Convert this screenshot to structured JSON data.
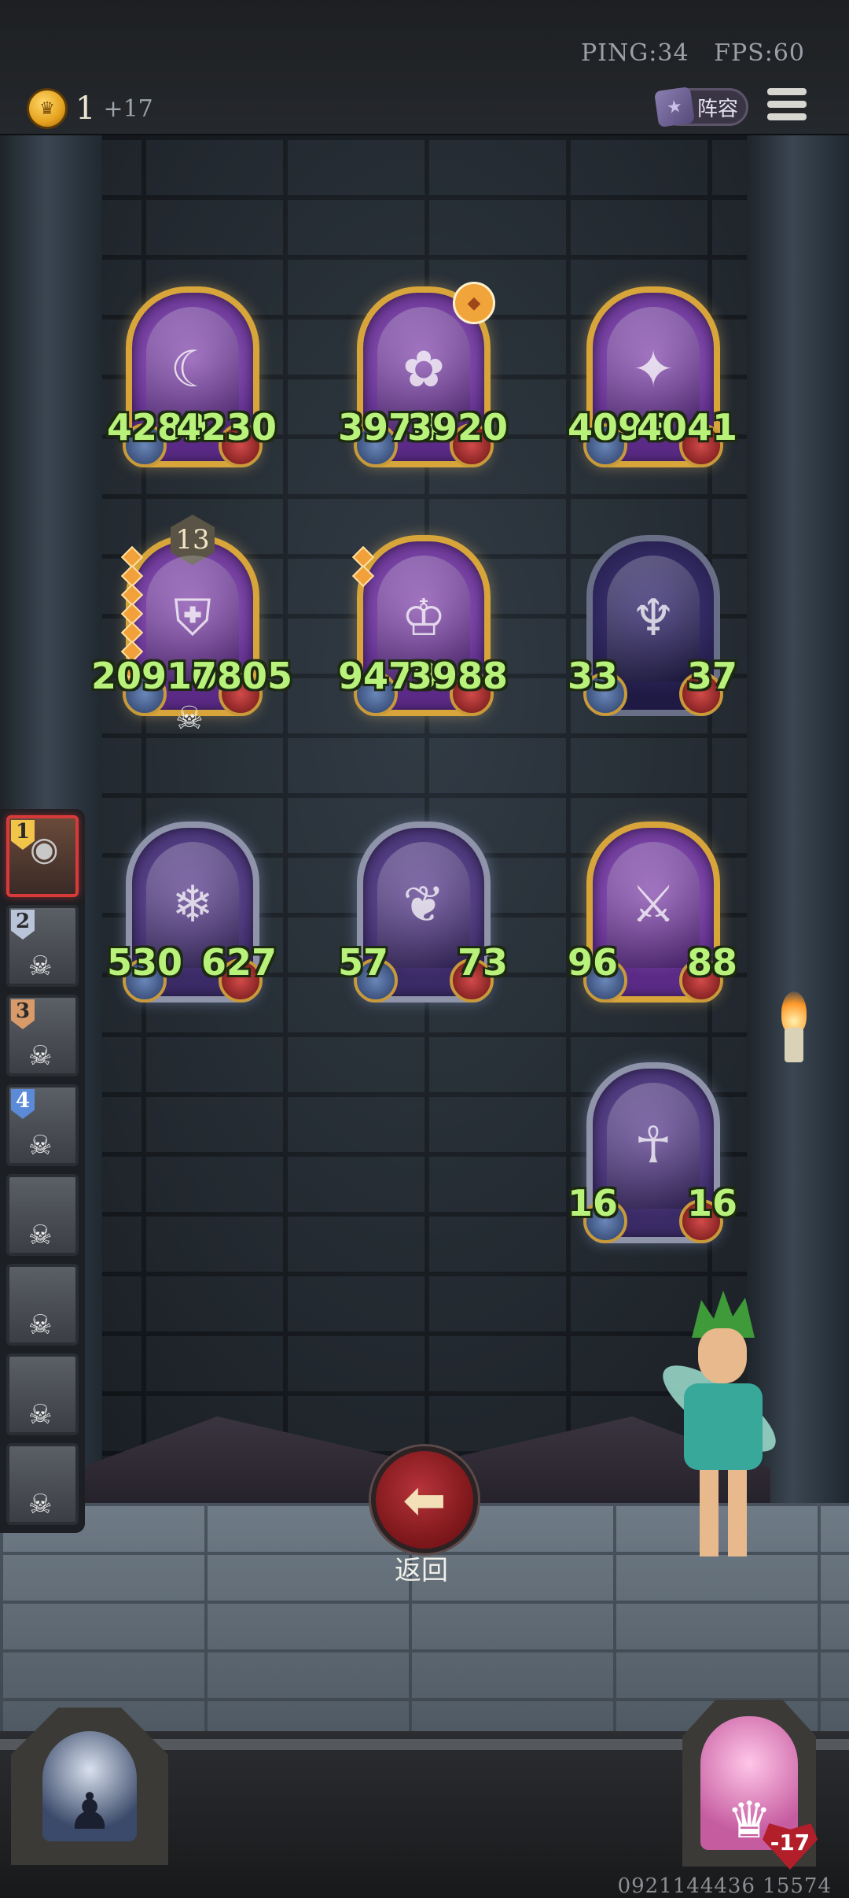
{
  "topbar": {
    "ping": "PING:34",
    "fps": "FPS:60",
    "gold_value": "1",
    "gold_income": "+17",
    "lineup_label": "阵容"
  },
  "board": {
    "row1": [
      {
        "atk": "4289",
        "hp": "4230"
      },
      {
        "atk": "3974",
        "hp": "3920"
      },
      {
        "atk": "4096",
        "hp": "4041"
      }
    ],
    "row2": [
      {
        "atk": "20910",
        "hp": "17805",
        "level": "13"
      },
      {
        "atk": "9479",
        "hp": "3988"
      },
      {
        "atk": "33",
        "hp": "37"
      }
    ],
    "row3": [
      {
        "atk": "530",
        "hp": "627"
      },
      {
        "atk": "57",
        "hp": "73"
      },
      {
        "atk": "96",
        "hp": "88"
      }
    ],
    "row4": [
      {
        "atk": "16",
        "hp": "16"
      }
    ]
  },
  "side_list": [
    "1",
    "2",
    "3",
    "4"
  ],
  "back_button": {
    "label": "返回"
  },
  "opponent": {
    "hp_delta": "-17"
  },
  "footer": {
    "seed": "0921144436 15574"
  },
  "colors": {
    "stat_green": "#b9f27a",
    "gold_frame": "#d7a53a",
    "back_red": "#b6333a"
  }
}
